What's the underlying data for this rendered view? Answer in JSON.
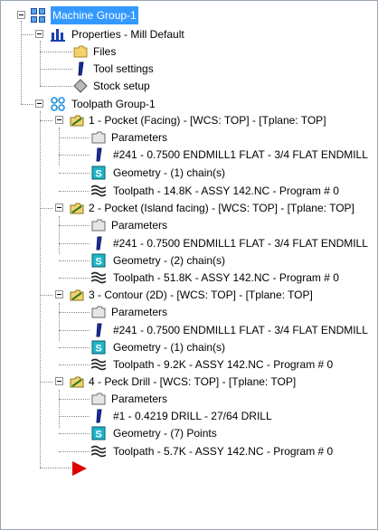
{
  "tree": {
    "root": {
      "label": "Machine Group-1"
    },
    "properties": {
      "label": "Properties - Mill Default",
      "children": [
        "Files",
        "Tool settings",
        "Stock setup"
      ]
    },
    "toolpath_group": {
      "label": "Toolpath Group-1"
    },
    "operations": [
      {
        "label": "1 - Pocket (Facing) - [WCS: TOP] - [Tplane: TOP]",
        "parameters": "Parameters",
        "tool": "#241 - 0.7500 ENDMILL1 FLAT -  3/4 FLAT ENDMILL",
        "geometry": "Geometry - (1) chain(s)",
        "toolpath": "Toolpath - 14.8K - ASSY 142.NC - Program # 0"
      },
      {
        "label": "2 - Pocket (Island facing) - [WCS: TOP] - [Tplane: TOP]",
        "parameters": "Parameters",
        "tool": "#241 - 0.7500 ENDMILL1 FLAT -  3/4 FLAT ENDMILL",
        "geometry": "Geometry - (2) chain(s)",
        "toolpath": "Toolpath - 51.8K - ASSY 142.NC - Program # 0"
      },
      {
        "label": "3 - Contour (2D) - [WCS: TOP] - [Tplane: TOP]",
        "parameters": "Parameters",
        "tool": "#241 - 0.7500 ENDMILL1 FLAT -  3/4 FLAT ENDMILL",
        "geometry": "Geometry - (1) chain(s)",
        "toolpath": "Toolpath - 9.2K - ASSY 142.NC - Program # 0"
      },
      {
        "label": "4 - Peck Drill - [WCS: TOP] - [Tplane: TOP]",
        "parameters": "Parameters",
        "tool": "#1 - 0.4219 DRILL -  27/64 DRILL",
        "geometry": "Geometry - (7) Points",
        "toolpath": "Toolpath - 5.7K - ASSY 142.NC - Program # 0"
      }
    ]
  },
  "colors": {
    "selection": "#3399ff",
    "insert_arrow": "#e00000",
    "tool_blue": "#1a2fa0",
    "geometry_cyan": "#1fb5c8",
    "folder_yellow": "#f3d26b"
  },
  "icons": {
    "root": "machine-group-icon",
    "properties": "properties-icon",
    "files": "folder-icon",
    "tool_settings": "tool-icon",
    "stock_setup": "stock-icon",
    "toolpath_group": "toolpath-group-icon",
    "operation": "operation-icon",
    "parameters": "parameters-folder-icon",
    "geometry": "geometry-icon",
    "toolpath": "toolpath-icon",
    "insert": "insert-arrow-icon"
  }
}
